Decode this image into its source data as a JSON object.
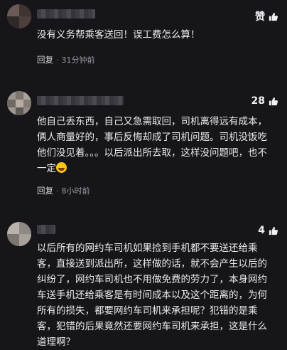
{
  "comments": [
    {
      "likes": "赞",
      "text": "没有义务帮乘客送回！误工费怎么算！",
      "reply_label": "回复",
      "time": "31分钟前"
    },
    {
      "likes": "28",
      "text": "他自己丢东西，自己又急需取回，司机离得远有成本，俩人商量好的，事后反悔却成了司机问题。司机没饭吃他们没见着。。。以后派出所去取，这样没问题吧，也不一定",
      "emoji": "grinning-sweat-emoji",
      "reply_label": "回复",
      "time": "8小时前"
    },
    {
      "likes": "4",
      "text": "以后所有的网约车司机如果捡到手机都不要送还给乘客，直接送到派出所，这样做的话，就不会产生以后的纠纷了，网约车司机也不用做免费的劳力了，本身网约车送手机还给乘客是有时间成本以及这个距离的，为何所有的损失，都要网约车司机来承担呢？犯错的是乘客，犯错的后果竟然还要网约车司机来承担，这是什么道理啊？"
    }
  ],
  "colors": {
    "background": "#16161a",
    "text": "#ececec",
    "meta": "#9a9aa0"
  }
}
